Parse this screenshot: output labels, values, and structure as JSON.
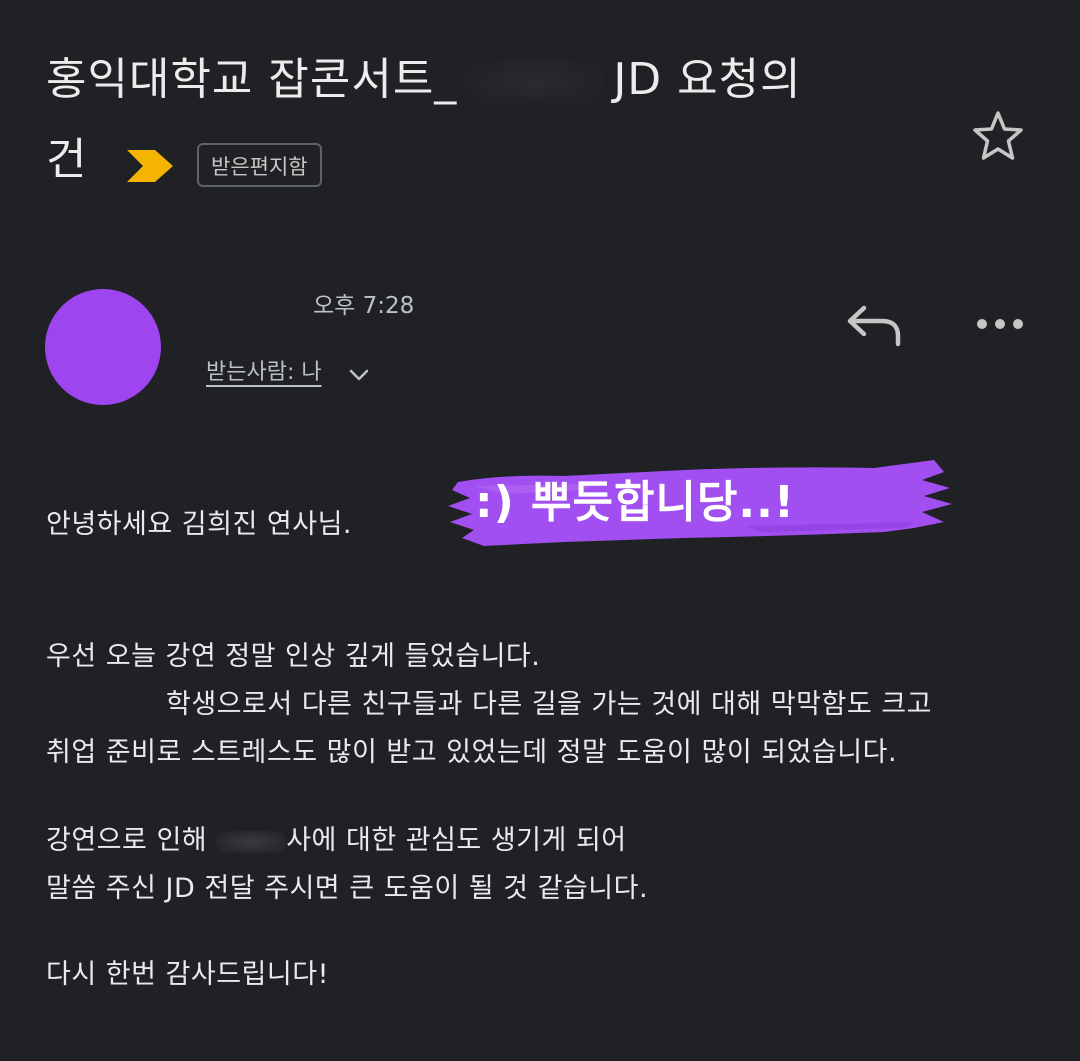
{
  "email": {
    "subject_part1": "홍익대학교 잡콘서트_",
    "subject_part2": "JD 요청의",
    "subject_line2": "건",
    "label": "받은편지함",
    "time": "오후 7:28",
    "recipient": "받는사람: 나"
  },
  "sticker": {
    "text": ":) 뿌듯합니당..!"
  },
  "body": {
    "greeting": "안녕하세요 김희진 연사님.",
    "p1_line1": "우선 오늘 강연 정말 인상 깊게 들었습니다.",
    "p1_line2": "학생으로서 다른 친구들과 다른 길을 가는 것에 대해 막막함도 크고",
    "p1_line3": "취업 준비로 스트레스도 많이 받고 있었는데 정말 도움이 많이 되었습니다.",
    "p2_line1_a": "강연으로 인해",
    "p2_line1_b": "사에 대한 관심도 생기게 되어",
    "p2_line2": "말씀 주신 JD 전달 주시면 큰 도움이 될 것 같습니다.",
    "closing": "다시 한번 감사드립니다!"
  },
  "colors": {
    "background": "#202124",
    "avatar": "#9f45f0",
    "importance": "#f4b400",
    "sticker": "#a14ff0"
  },
  "icons": [
    "importance-marker-icon",
    "star-icon",
    "reply-icon",
    "more-options-icon",
    "chevron-down-icon"
  ]
}
